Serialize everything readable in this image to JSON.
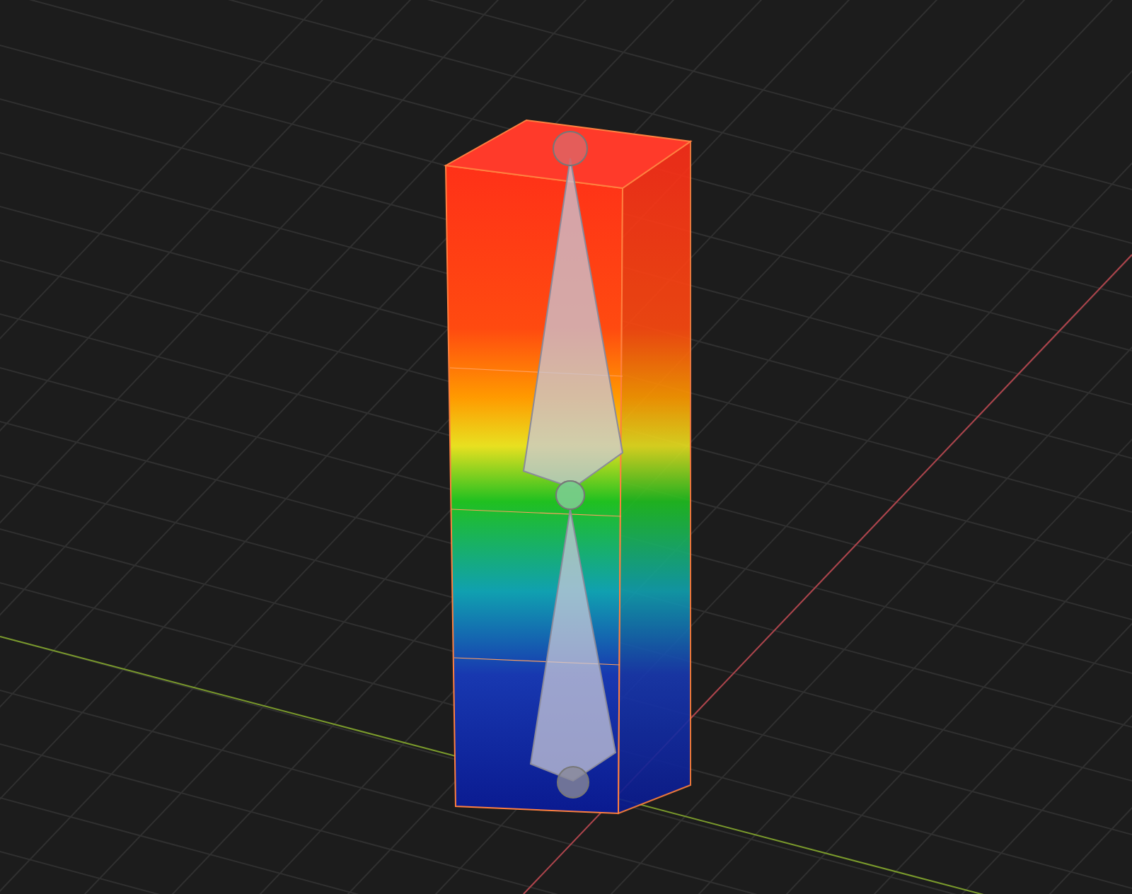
{
  "viewport": {
    "objects": [
      {
        "kind": "box"
      },
      {
        "kind": "bone"
      },
      {
        "kind": "bone"
      }
    ]
  }
}
